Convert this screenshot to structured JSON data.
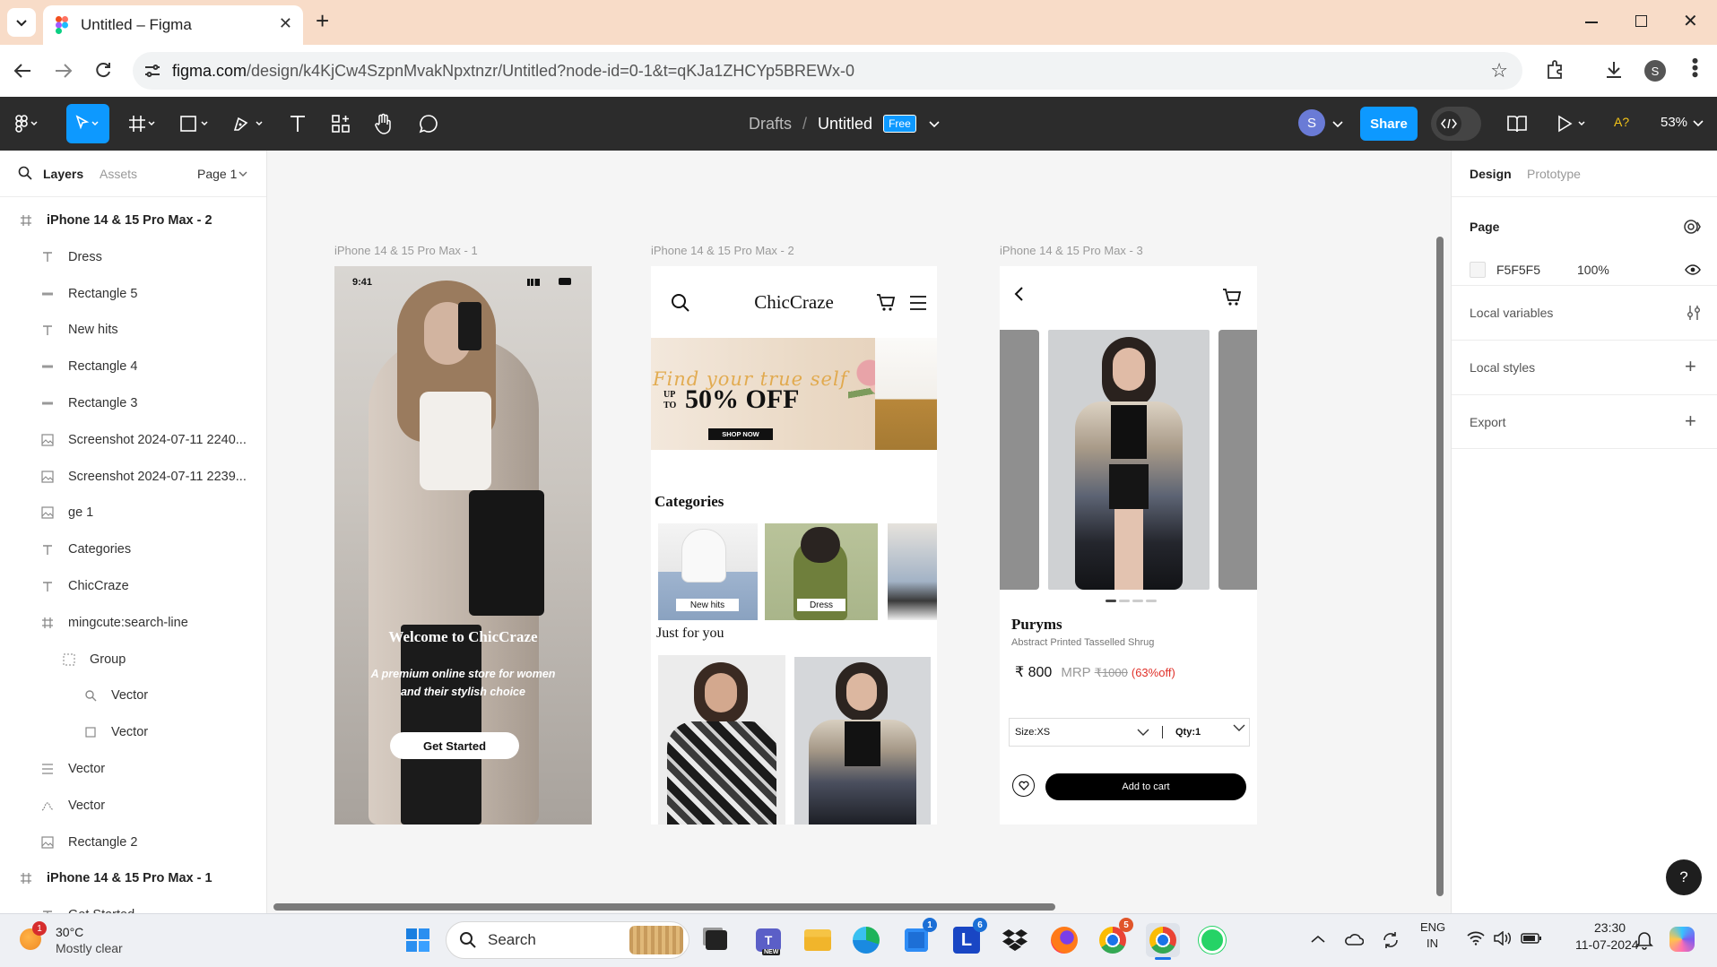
{
  "browser": {
    "tab_title": "Untitled – Figma",
    "url_host": "figma.com",
    "url_path": "/design/k4KjCw4SzpnMvakNpxtnzr/Untitled?node-id=0-1&t=qKJa1ZHCYp5BREWx-0",
    "profile_initial": "S"
  },
  "toolbar": {
    "breadcrumb_drafts": "Drafts",
    "separator": "/",
    "file_name": "Untitled",
    "plan_badge": "Free",
    "avatar_initial": "S",
    "share_label": "Share",
    "font_warning": "A?",
    "zoom": "53%"
  },
  "left_panel": {
    "tab_layers": "Layers",
    "tab_assets": "Assets",
    "page_selector": "Page 1",
    "layers": [
      {
        "name": "iPhone 14 & 15 Pro Max - 2",
        "icon": "frame-icon",
        "bold": true
      },
      {
        "name": "Dress",
        "icon": "text-icon"
      },
      {
        "name": "Rectangle 5",
        "icon": "rectangle-icon"
      },
      {
        "name": "New hits",
        "icon": "text-icon"
      },
      {
        "name": "Rectangle 4",
        "icon": "rectangle-icon"
      },
      {
        "name": "Rectangle 3",
        "icon": "rectangle-icon"
      },
      {
        "name": "Screenshot 2024-07-11 2240...",
        "icon": "image-icon"
      },
      {
        "name": "Screenshot 2024-07-11 2239...",
        "icon": "image-icon"
      },
      {
        "name": "ge 1",
        "icon": "image-icon"
      },
      {
        "name": "Categories",
        "icon": "text-icon"
      },
      {
        "name": "ChicCraze",
        "icon": "text-icon"
      },
      {
        "name": "mingcute:search-line",
        "icon": "frame-icon"
      },
      {
        "name": "Group",
        "icon": "group-icon"
      },
      {
        "name": "Vector",
        "icon": "vector-search-icon"
      },
      {
        "name": "Vector",
        "icon": "vector-square-icon"
      },
      {
        "name": "Vector",
        "icon": "vector-lines-icon"
      },
      {
        "name": "Vector",
        "icon": "vector-path-icon"
      },
      {
        "name": "Rectangle 2",
        "icon": "image-icon"
      },
      {
        "name": "iPhone 14 & 15 Pro Max - 1",
        "icon": "frame-icon",
        "bold": true
      },
      {
        "name": "Get Started",
        "icon": "text-icon"
      }
    ]
  },
  "canvas": {
    "frame1": {
      "label": "iPhone 14 & 15 Pro Max - 1",
      "status_time": "9:41",
      "welcome": "Welcome to ChicCraze",
      "tagline_line1": "A premium online store for women",
      "tagline_line2": "and their stylish choice",
      "cta": "Get Started"
    },
    "frame2": {
      "label": "iPhone 14 & 15 Pro Max - 2",
      "brand": "ChicCraze",
      "banner_script": "Find your true self",
      "banner_upto_1": "UP",
      "banner_upto_2": "TO",
      "banner_offer": "50% OFF",
      "banner_cta": "SHOP NOW",
      "categories_title": "Categories",
      "category_1": "New hits",
      "category_2": "Dress",
      "just_for_you": "Just for you"
    },
    "frame3": {
      "label": "iPhone 14 & 15 Pro Max - 3",
      "product_name": "Puryms",
      "product_desc": "Abstract Printed Tasselled Shrug",
      "price": "₹ 800",
      "mrp_label": "MRP",
      "mrp_value": "₹1000",
      "discount": "(63%off)",
      "size": "Size:XS",
      "qty": "Qty:1",
      "add_to_cart": "Add to  cart"
    }
  },
  "right_panel": {
    "tab_design": "Design",
    "tab_prototype": "Prototype",
    "page_heading": "Page",
    "page_color": "F5F5F5",
    "page_opacity": "100%",
    "local_variables": "Local variables",
    "local_styles": "Local styles",
    "export": "Export",
    "help": "?"
  },
  "taskbar": {
    "temperature": "30°C",
    "weather": "Mostly clear",
    "weather_badge": "1",
    "search_placeholder": "Search",
    "teams_badge": "NEW",
    "store_badge": "1",
    "l_badge": "6",
    "chrome_badge": "5",
    "lang_1": "ENG",
    "lang_2": "IN",
    "time": "23:30",
    "date": "11-07-2024"
  },
  "colors": {
    "accent": "#0d99ff",
    "toolbar_bg": "#2c2c2c",
    "tabbar_bg": "#f8dcc8",
    "discount_red": "#e0312a"
  }
}
